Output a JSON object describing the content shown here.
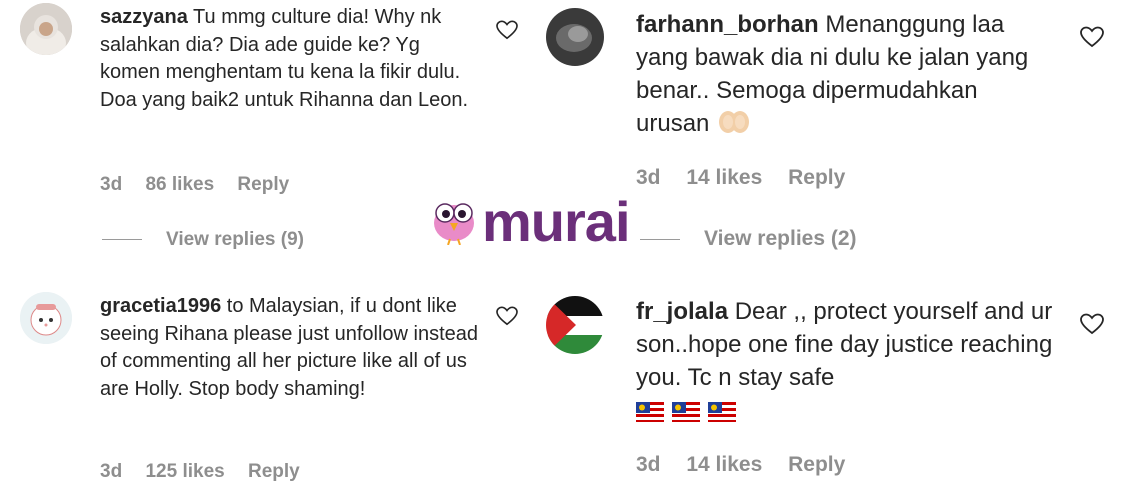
{
  "comments": [
    {
      "username": "sazzyana",
      "text": "Tu mmg culture dia! Why nk salahkan dia? Dia ade guide ke? Yg komen menghentam tu kena la fikir dulu. Doa yang baik2 untuk Rihanna dan Leon.",
      "time": "3d",
      "likes": "86 likes",
      "reply": "Reply",
      "view_replies": "View replies (9)",
      "avatar": "profile-photo-woman-hijab"
    },
    {
      "username": "farhann_borhan",
      "text": "Menanggung laa yang bawak dia ni dulu ke jalan yang benar.. Semoga dipermudahkan urusan",
      "emoji": "folded-hands-emoji",
      "time": "3d",
      "likes": "14 likes",
      "reply": "Reply",
      "view_replies": "View replies (2)",
      "avatar": "profile-photo-dark"
    },
    {
      "username": "gracetia1996",
      "text": "to Malaysian, if u dont like seeing Rihana please just unfollow instead of commenting all her picture like all of us are Holly. Stop body shaming!",
      "time": "3d",
      "likes": "125 likes",
      "reply": "Reply",
      "avatar": "cartoon-cat-avatar"
    },
    {
      "username": "fr_jolala",
      "text": "Dear ,, protect yourself and ur son..hope one fine day justice reaching you. Tc n stay safe",
      "emoji": "malaysia-flag-emoji",
      "time": "3d",
      "likes": "14 likes",
      "reply": "Reply",
      "avatar": "palestine-flag-avatar"
    }
  ],
  "watermark": {
    "brand": "murai",
    "color": "#6b2f7a",
    "mascot": "pink-bird-mascot"
  },
  "colors": {
    "text": "#262626",
    "meta": "#8e8e8e"
  }
}
